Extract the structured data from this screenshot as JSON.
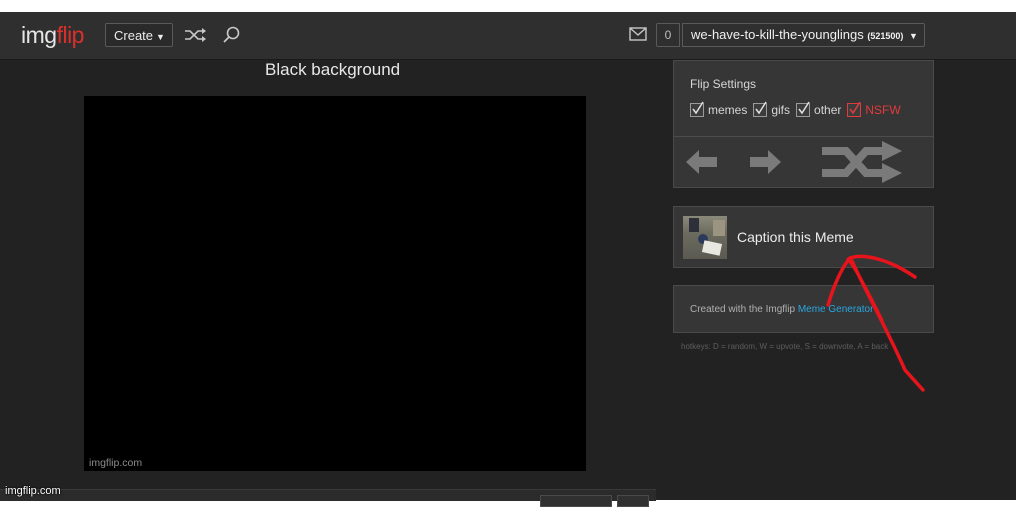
{
  "header": {
    "logo_img": "img",
    "logo_flip": "flip",
    "create_label": "Create",
    "notification_count": "0",
    "username": "we-have-to-kill-the-younglings",
    "user_points": "(521500)"
  },
  "image": {
    "title": "Black background",
    "watermark": "imgflip.com"
  },
  "flip_settings": {
    "title": "Flip Settings",
    "options": [
      {
        "label": "memes",
        "checked": true
      },
      {
        "label": "gifs",
        "checked": true
      },
      {
        "label": "other",
        "checked": true
      },
      {
        "label": "NSFW",
        "checked": true
      }
    ]
  },
  "caption": {
    "label": "Caption this Meme"
  },
  "credit": {
    "prefix": "Created with the Imgflip ",
    "link": "Meme Generator"
  },
  "hotkeys": "hotkeys: D = random, W = upvote, S = downvote, A = back",
  "site_watermark": "imgflip.com",
  "colors": {
    "brand_red": "#d9302d",
    "link_blue": "#2aa6e0",
    "annotation_red": "#e8141c"
  }
}
